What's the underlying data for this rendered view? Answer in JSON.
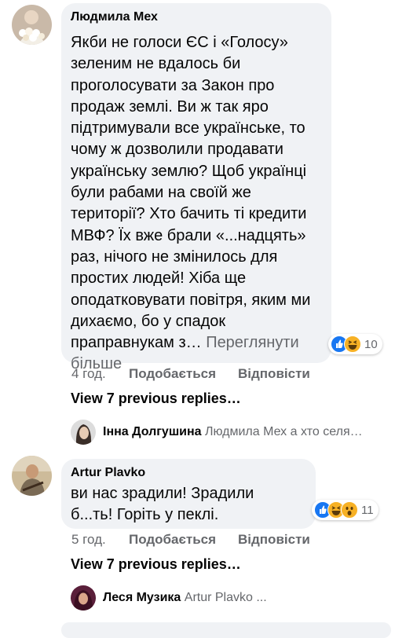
{
  "comments": [
    {
      "author": "Людмила Мех",
      "text_lines": [
        "Якби не голоси ЄС і «Голосу»",
        "зеленим не вдалось би",
        "проголосувати за Закон про",
        "продаж землі. Ви ж так яро",
        "підтримували все українське, то",
        "чому ж дозволили продавати",
        "українську землю? Щоб українці",
        "були рабами на своїй же",
        "території? Хто бачить ті кредити",
        "МВФ? Їх вже брали «...надцять»",
        "раз, нічого не змінилось для",
        "простих людей! Хіба ще",
        "оподатковувати повітря, яким ми",
        "дихаємо, бо у спадок",
        "праправнукам з…"
      ],
      "see_more_1": "Переглянути",
      "see_more_2": "більше",
      "reactions": {
        "icons": [
          "like-icon",
          "haha-icon"
        ],
        "count": "10"
      },
      "time": "4 год.",
      "like_label": "Подобається",
      "reply_label": "Відповісти",
      "view_replies": "View 7 previous replies…",
      "latest_reply": {
        "name": "Інна Долгушина",
        "preview": "Людмила Мех а хто селя…"
      }
    },
    {
      "author": "Artur Plavko",
      "text_lines": [
        "ви нас зрадили! Зрадили",
        "б...ть! Горіть у пеклі."
      ],
      "reactions": {
        "icons": [
          "like-icon",
          "haha-icon",
          "wow-icon"
        ],
        "count": "11"
      },
      "time": "5 год.",
      "like_label": "Подобається",
      "reply_label": "Відповісти",
      "view_replies": "View 7 previous replies…",
      "latest_reply": {
        "name": "Леся Музика",
        "preview": "Artur Plavko ..."
      }
    }
  ],
  "colors": {
    "bubble": "#f0f2f5",
    "secondary_text": "#65676b",
    "like_blue": "#1877f2",
    "haha_yellow": "#f7b125"
  }
}
